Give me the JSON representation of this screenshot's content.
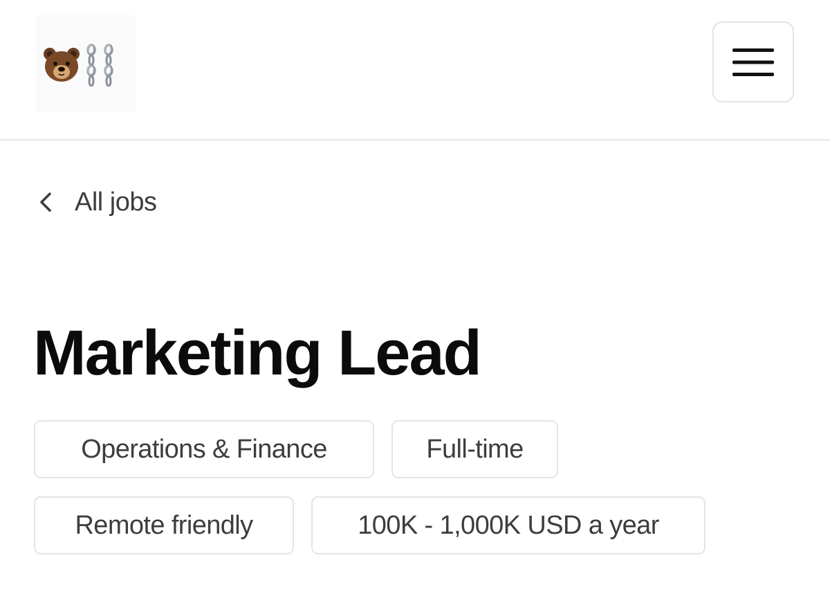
{
  "header": {
    "logo": {
      "icons": [
        "bear-face-icon",
        "chains-icon"
      ]
    },
    "menu_button": {
      "icon": "hamburger-menu-icon"
    }
  },
  "back_link": {
    "icon": "chevron-left-icon",
    "label": "All jobs"
  },
  "job": {
    "title": "Marketing Lead",
    "tags": [
      "Operations & Finance",
      "Full-time",
      "Remote friendly",
      "100K - 1,000K USD a year"
    ]
  },
  "colors": {
    "text_primary": "#0b0b0b",
    "text_secondary": "#3d3d40",
    "border": "#e4e4e7",
    "background": "#ffffff"
  }
}
